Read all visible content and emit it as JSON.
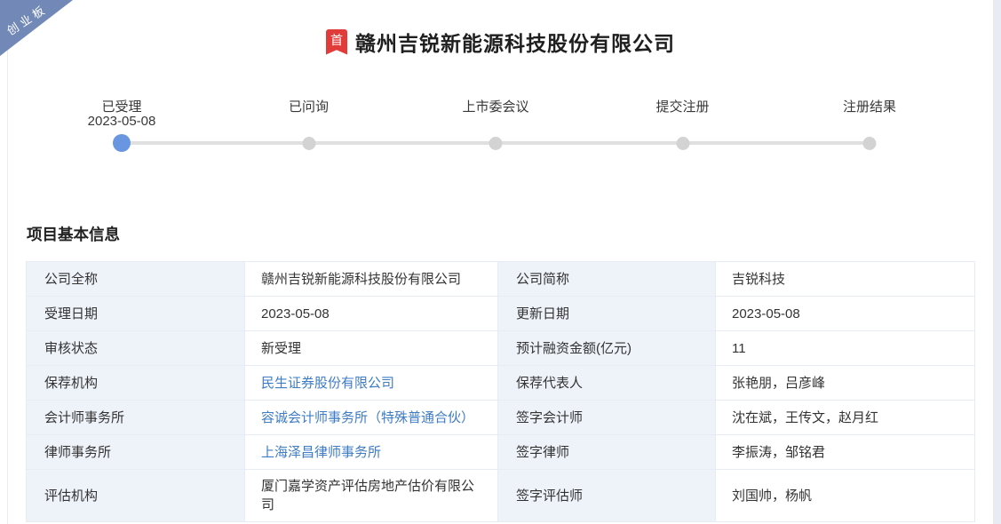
{
  "ribbon": {
    "label": "创业板"
  },
  "header": {
    "badge": "首",
    "title": "赣州吉锐新能源科技股份有限公司"
  },
  "timeline": [
    {
      "label": "已受理",
      "date": "2023-05-08",
      "state": "active"
    },
    {
      "label": "已问询",
      "state": "pending"
    },
    {
      "label": "上市委会议",
      "state": "pending"
    },
    {
      "label": "提交注册",
      "state": "pending"
    },
    {
      "label": "注册结果",
      "state": "pending"
    }
  ],
  "section_title": "项目基本信息",
  "info_table": {
    "rows": [
      {
        "cells": [
          {
            "label": "公司全称",
            "value": "赣州吉锐新能源科技股份有限公司",
            "link": false
          },
          {
            "label": "公司简称",
            "value": "吉锐科技",
            "link": false
          }
        ]
      },
      {
        "cells": [
          {
            "label": "受理日期",
            "value": "2023-05-08",
            "link": false
          },
          {
            "label": "更新日期",
            "value": "2023-05-08",
            "link": false
          }
        ]
      },
      {
        "cells": [
          {
            "label": "审核状态",
            "value": "新受理",
            "link": false
          },
          {
            "label": "预计融资金额(亿元)",
            "value": "11",
            "link": false
          }
        ]
      },
      {
        "cells": [
          {
            "label": "保荐机构",
            "value": "民生证券股份有限公司",
            "link": true
          },
          {
            "label": "保荐代表人",
            "value": "张艳朋，吕彦峰",
            "link": false
          }
        ]
      },
      {
        "cells": [
          {
            "label": "会计师事务所",
            "value": "容诚会计师事务所（特殊普通合伙）",
            "link": true
          },
          {
            "label": "签字会计师",
            "value": "沈在斌，王传文，赵月红",
            "link": false
          }
        ]
      },
      {
        "cells": [
          {
            "label": "律师事务所",
            "value": "上海泽昌律师事务所",
            "link": true
          },
          {
            "label": "签字律师",
            "value": "李振涛，邹铭君",
            "link": false
          }
        ]
      },
      {
        "cells": [
          {
            "label": "评估机构",
            "value": "厦门嘉学资产评估房地产估价有限公司",
            "link": false
          },
          {
            "label": "签字评估师",
            "value": "刘国帅，杨帆",
            "link": false
          }
        ]
      }
    ]
  },
  "colors": {
    "ribbon_blue": "#7289b7",
    "badge_red": "#e23c3a",
    "active_dot_blue": "#6896e0",
    "pending_dot_gray": "#d3d3d3",
    "track_gray": "#e0e0e0",
    "label_cell_bg": "#eef2f9",
    "table_border": "#e7ebf4",
    "link_blue": "#3e7cc5"
  }
}
